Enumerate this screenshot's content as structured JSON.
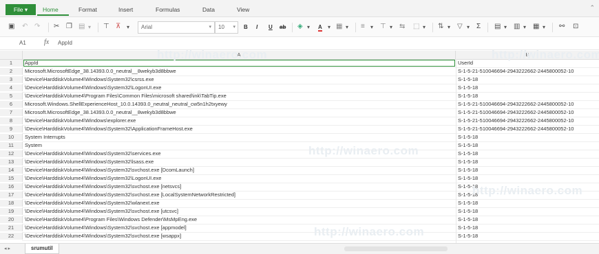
{
  "menu": {
    "file": "File",
    "tabs": [
      "Home",
      "Format",
      "Insert",
      "Formulas",
      "Data",
      "View"
    ]
  },
  "toolbar": {
    "font_name": "Arial",
    "font_size": "10",
    "bold": "B",
    "italic": "I",
    "underline": "U",
    "strike": "ab",
    "font_color": "A",
    "sum": "Σ"
  },
  "formula_bar": {
    "cell_ref": "A1",
    "fx": "fx",
    "content": "AppId"
  },
  "columns": [
    "A",
    "B"
  ],
  "rows": [
    {
      "n": "1",
      "a": "AppId",
      "b": "UserId"
    },
    {
      "n": "2",
      "a": "Microsoft.MicrosoftEdge_38.14393.0.0_neutral__8wekyb3d8bbwe",
      "b": "S-1-5-21-510046694-2943222662-2445800052-10"
    },
    {
      "n": "3",
      "a": "\\Device\\HarddiskVolume4\\Windows\\System32\\csrss.exe",
      "b": "S-1-5-18"
    },
    {
      "n": "4",
      "a": "\\Device\\HarddiskVolume4\\Windows\\System32\\LogonUI.exe",
      "b": "S-1-5-18"
    },
    {
      "n": "5",
      "a": "\\Device\\HarddiskVolume4\\Program Files\\Common Files\\microsoft shared\\ink\\TabTip.exe",
      "b": "S-1-5-18"
    },
    {
      "n": "6",
      "a": "Microsoft.Windows.ShellExperienceHost_10.0.14393.0_neutral_neutral_cw5n1h2txyewy",
      "b": "S-1-5-21-510046694-2943222662-2445800052-10"
    },
    {
      "n": "7",
      "a": "Microsoft.MicrosoftEdge_38.14393.0.0_neutral__8wekyb3d8bbwe",
      "b": "S-1-5-21-510046694-2943222662-2445800052-10"
    },
    {
      "n": "8",
      "a": "\\Device\\HarddiskVolume4\\Windows\\explorer.exe",
      "b": "S-1-5-21-510046694-2943222662-2445800052-10"
    },
    {
      "n": "9",
      "a": "\\Device\\HarddiskVolume4\\Windows\\System32\\ApplicationFrameHost.exe",
      "b": "S-1-5-21-510046694-2943222662-2445800052-10"
    },
    {
      "n": "10",
      "a": "System Interrupts",
      "b": "S-1-5-18"
    },
    {
      "n": "11",
      "a": "System",
      "b": "S-1-5-18"
    },
    {
      "n": "12",
      "a": "\\Device\\HarddiskVolume4\\Windows\\System32\\services.exe",
      "b": "S-1-5-18"
    },
    {
      "n": "13",
      "a": "\\Device\\HarddiskVolume4\\Windows\\System32\\lsass.exe",
      "b": "S-1-5-18"
    },
    {
      "n": "14",
      "a": "\\Device\\HarddiskVolume4\\Windows\\System32\\svchost.exe [DcomLaunch]",
      "b": "S-1-5-18"
    },
    {
      "n": "15",
      "a": "\\Device\\HarddiskVolume4\\Windows\\System32\\LogonUI.exe",
      "b": "S-1-5-18"
    },
    {
      "n": "16",
      "a": "\\Device\\HarddiskVolume4\\Windows\\System32\\svchost.exe [netsvcs]",
      "b": "S-1-5-18"
    },
    {
      "n": "17",
      "a": "\\Device\\HarddiskVolume4\\Windows\\System32\\svchost.exe [LocalSystemNetworkRestricted]",
      "b": "S-1-5-18"
    },
    {
      "n": "18",
      "a": "\\Device\\HarddiskVolume4\\Windows\\System32\\wlanext.exe",
      "b": "S-1-5-18"
    },
    {
      "n": "19",
      "a": "\\Device\\HarddiskVolume4\\Windows\\System32\\svchost.exe [utcsvc]",
      "b": "S-1-5-18"
    },
    {
      "n": "20",
      "a": "\\Device\\HarddiskVolume4\\Program Files\\Windows Defender\\MsMpEng.exe",
      "b": "S-1-5-18"
    },
    {
      "n": "21",
      "a": "\\Device\\HarddiskVolume4\\Windows\\System32\\svchost.exe [appmodel]",
      "b": "S-1-5-18"
    },
    {
      "n": "22",
      "a": "\\Device\\HarddiskVolume4\\Windows\\System32\\svchost.exe [wsappx]",
      "b": "S-1-5-18"
    }
  ],
  "watermark": "http://winaero.com",
  "sheet_tab": "srumutil",
  "colors": {
    "accent": "#2f8f3a"
  }
}
